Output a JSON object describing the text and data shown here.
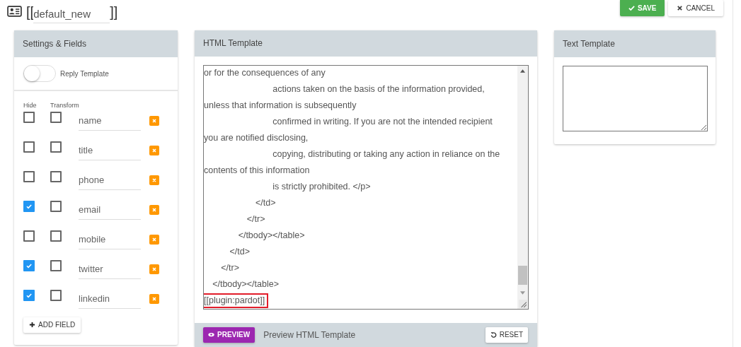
{
  "header": {
    "open_bracket": "[[",
    "template_name": "default_new",
    "close_bracket": "]]"
  },
  "actions": {
    "save": "SAVE",
    "cancel": "CANCEL"
  },
  "settings": {
    "title": "Settings & Fields",
    "reply_template": {
      "label": "Reply Template",
      "on": false
    },
    "columns": [
      "Hide",
      "Transform"
    ],
    "fields": [
      {
        "name": "name",
        "hide": false,
        "transform": false
      },
      {
        "name": "title",
        "hide": false,
        "transform": false
      },
      {
        "name": "phone",
        "hide": false,
        "transform": false
      },
      {
        "name": "email",
        "hide": true,
        "transform": false
      },
      {
        "name": "mobile",
        "hide": false,
        "transform": false
      },
      {
        "name": "twitter",
        "hide": true,
        "transform": false
      },
      {
        "name": "linkedin",
        "hide": true,
        "transform": false
      }
    ],
    "add_field": "ADD FIELD"
  },
  "html_template": {
    "title": "HTML Template",
    "lines": [
      {
        "text": "or for the consequences of any",
        "highlighted": false
      },
      {
        "text": "\t\t\t\t\t\t\t\tactions taken on the basis of the information provided,",
        "highlighted": false
      },
      {
        "text": "unless that information is subsequently",
        "highlighted": false
      },
      {
        "text": "\t\t\t\t\t\t\t\tconfirmed in writing. If you are not the intended recipient",
        "highlighted": false
      },
      {
        "text": "you are notified disclosing,",
        "highlighted": false
      },
      {
        "text": "\t\t\t\t\t\t\t\tcopying, distributing or taking any action in reliance on the",
        "highlighted": false
      },
      {
        "text": "contents of this information",
        "highlighted": false
      },
      {
        "text": "\t\t\t\t\t\t\t\tis strictly prohibited. </p>",
        "highlighted": false
      },
      {
        "text": "\t\t\t\t\t\t</td>",
        "highlighted": false
      },
      {
        "text": "\t\t\t\t\t</tr>",
        "highlighted": false
      },
      {
        "text": "\t\t\t\t</tbody></table>",
        "highlighted": false
      },
      {
        "text": "\t\t\t</td>",
        "highlighted": false
      },
      {
        "text": "\t\t</tr>",
        "highlighted": false
      },
      {
        "text": "\t</tbody></table>",
        "highlighted": false
      },
      {
        "text": "[[plugin:pardot]]",
        "highlighted": true
      }
    ],
    "preview_button": "PREVIEW",
    "preview_label": "Preview HTML Template",
    "reset": "RESET"
  },
  "text_template": {
    "title": "Text Template"
  }
}
